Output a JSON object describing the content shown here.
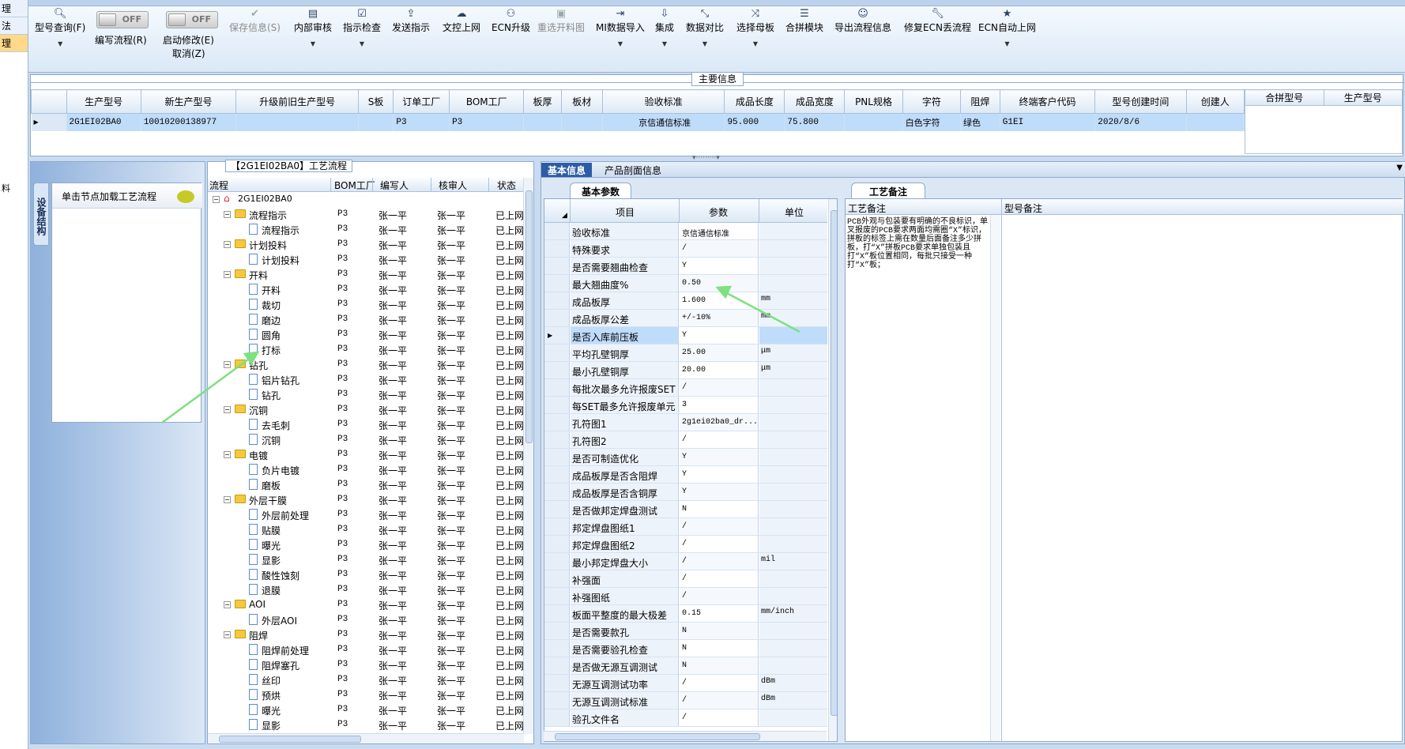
{
  "left_strip": {
    "items": [
      "理",
      "法",
      "理"
    ],
    "frag": "料"
  },
  "toolbar": {
    "model_query": "型号查询(F)",
    "write_flow": "编写流程(R)",
    "auto_modify": "启动修改(E)",
    "cancel": "取消(Z)",
    "toggle_off": "OFF",
    "save_info": "保存信息(S)",
    "internal_review": "内部审核",
    "instruction_check": "指示检查",
    "send_instruction": "发送指示",
    "upload_doc": "文控上网",
    "ecn_upgrade": "ECN升级",
    "reselect_drawing": "重选开料图",
    "mi_import": "MI数据导入",
    "integrate": "集成",
    "data_compare": "数据对比",
    "select_master": "选择母板",
    "merge_module": "合拼模块",
    "export_flow": "导出流程信息",
    "repair_ecn": "修复ECN丢流程",
    "ecn_auto_upload": "ECN自动上网"
  },
  "main_info": {
    "title": "主要信息",
    "columns": [
      "生产型号",
      "新生产型号",
      "升级前旧生产型号",
      "S板",
      "订单工厂",
      "BOM工厂",
      "板厚",
      "板材",
      "验收标准",
      "成品长度",
      "成品宽度",
      "PNL规格",
      "字符",
      "阻焊",
      "终端客户代码",
      "型号创建时间",
      "创建人"
    ],
    "row": [
      "2G1EI02BA0",
      "10010200138977",
      "",
      "",
      "P3",
      "P3",
      "",
      "",
      "京信通信标准",
      "95.000",
      "75.800",
      "",
      "白色字符",
      "绿色",
      "G1EI",
      "2020/8/6",
      ""
    ],
    "side_columns": [
      "合拼型号",
      "生产型号"
    ]
  },
  "left_panel": {
    "vtab": "设备结构",
    "msg": "单击节点加载工艺流程"
  },
  "tree": {
    "title": "【2G1EI02BA0】工艺流程",
    "columns": [
      "流程",
      "BOM工厂",
      "编写人",
      "核审人",
      "状态"
    ],
    "root": "2G1EI02BA0",
    "rows": [
      {
        "name": "流程指示",
        "lvl": 1,
        "f": "P3",
        "w": "张一平",
        "r": "张一平",
        "s": "已上网"
      },
      {
        "name": "流程指示",
        "lvl": 2,
        "f": "P3",
        "w": "张一平",
        "r": "张一平",
        "s": "已上网"
      },
      {
        "name": "计划投料",
        "lvl": 1,
        "f": "P3",
        "w": "张一平",
        "r": "张一平",
        "s": "已上网"
      },
      {
        "name": "计划投料",
        "lvl": 2,
        "f": "P3",
        "w": "张一平",
        "r": "张一平",
        "s": "已上网"
      },
      {
        "name": "开料",
        "lvl": 1,
        "f": "P3",
        "w": "张一平",
        "r": "张一平",
        "s": "已上网"
      },
      {
        "name": "开料",
        "lvl": 2,
        "f": "P3",
        "w": "张一平",
        "r": "张一平",
        "s": "已上网"
      },
      {
        "name": "裁切",
        "lvl": 2,
        "f": "P3",
        "w": "张一平",
        "r": "张一平",
        "s": "已上网"
      },
      {
        "name": "磨边",
        "lvl": 2,
        "f": "P3",
        "w": "张一平",
        "r": "张一平",
        "s": "已上网"
      },
      {
        "name": "圆角",
        "lvl": 2,
        "f": "P3",
        "w": "张一平",
        "r": "张一平",
        "s": "已上网"
      },
      {
        "name": "打标",
        "lvl": 2,
        "f": "P3",
        "w": "张一平",
        "r": "张一平",
        "s": "已上网"
      },
      {
        "name": "钻孔",
        "lvl": 1,
        "f": "P3",
        "w": "张一平",
        "r": "张一平",
        "s": "已上网"
      },
      {
        "name": "铝片钻孔",
        "lvl": 2,
        "f": "P3",
        "w": "张一平",
        "r": "张一平",
        "s": "已上网"
      },
      {
        "name": "钻孔",
        "lvl": 2,
        "f": "P3",
        "w": "张一平",
        "r": "张一平",
        "s": "已上网"
      },
      {
        "name": "沉铜",
        "lvl": 1,
        "f": "P3",
        "w": "张一平",
        "r": "张一平",
        "s": "已上网"
      },
      {
        "name": "去毛刺",
        "lvl": 2,
        "f": "P3",
        "w": "张一平",
        "r": "张一平",
        "s": "已上网"
      },
      {
        "name": "沉铜",
        "lvl": 2,
        "f": "P3",
        "w": "张一平",
        "r": "张一平",
        "s": "已上网"
      },
      {
        "name": "电镀",
        "lvl": 1,
        "f": "P3",
        "w": "张一平",
        "r": "张一平",
        "s": "已上网"
      },
      {
        "name": "负片电镀",
        "lvl": 2,
        "f": "P3",
        "w": "张一平",
        "r": "张一平",
        "s": "已上网"
      },
      {
        "name": "磨板",
        "lvl": 2,
        "f": "P3",
        "w": "张一平",
        "r": "张一平",
        "s": "已上网"
      },
      {
        "name": "外层干膜",
        "lvl": 1,
        "f": "P3",
        "w": "张一平",
        "r": "张一平",
        "s": "已上网"
      },
      {
        "name": "外层前处理",
        "lvl": 2,
        "f": "P3",
        "w": "张一平",
        "r": "张一平",
        "s": "已上网"
      },
      {
        "name": "贴膜",
        "lvl": 2,
        "f": "P3",
        "w": "张一平",
        "r": "张一平",
        "s": "已上网"
      },
      {
        "name": "曝光",
        "lvl": 2,
        "f": "P3",
        "w": "张一平",
        "r": "张一平",
        "s": "已上网"
      },
      {
        "name": "显影",
        "lvl": 2,
        "f": "P3",
        "w": "张一平",
        "r": "张一平",
        "s": "已上网"
      },
      {
        "name": "酸性蚀刻",
        "lvl": 2,
        "f": "P3",
        "w": "张一平",
        "r": "张一平",
        "s": "已上网"
      },
      {
        "name": "退膜",
        "lvl": 2,
        "f": "P3",
        "w": "张一平",
        "r": "张一平",
        "s": "已上网"
      },
      {
        "name": "AOI",
        "lvl": 1,
        "f": "P3",
        "w": "张一平",
        "r": "张一平",
        "s": "已上网"
      },
      {
        "name": "外层AOI",
        "lvl": 2,
        "f": "P3",
        "w": "张一平",
        "r": "张一平",
        "s": "已上网"
      },
      {
        "name": "阻焊",
        "lvl": 1,
        "f": "P3",
        "w": "张一平",
        "r": "张一平",
        "s": "已上网"
      },
      {
        "name": "阻焊前处理",
        "lvl": 2,
        "f": "P3",
        "w": "张一平",
        "r": "张一平",
        "s": "已上网"
      },
      {
        "name": "阻焊塞孔",
        "lvl": 2,
        "f": "P3",
        "w": "张一平",
        "r": "张一平",
        "s": "已上网"
      },
      {
        "name": "丝印",
        "lvl": 2,
        "f": "P3",
        "w": "张一平",
        "r": "张一平",
        "s": "已上网"
      },
      {
        "name": "预烘",
        "lvl": 2,
        "f": "P3",
        "w": "张一平",
        "r": "张一平",
        "s": "已上网"
      },
      {
        "name": "曝光",
        "lvl": 2,
        "f": "P3",
        "w": "张一平",
        "r": "张一平",
        "s": "已上网"
      },
      {
        "name": "显影",
        "lvl": 2,
        "f": "P3",
        "w": "张一平",
        "r": "张一平",
        "s": "已上网"
      }
    ]
  },
  "right_tabs": {
    "basic": "基本信息",
    "section": "产品剖面信息"
  },
  "params": {
    "tab": "基本参数",
    "columns": [
      "项目",
      "参数",
      "单位"
    ],
    "rows": [
      {
        "k": "验收标准",
        "v": "京信通信标准",
        "u": ""
      },
      {
        "k": "特殊要求",
        "v": "/",
        "u": ""
      },
      {
        "k": "是否需要翘曲检查",
        "v": "Y",
        "u": ""
      },
      {
        "k": "最大翘曲度%",
        "v": "0.50",
        "u": ""
      },
      {
        "k": "成品板厚",
        "v": "1.600",
        "u": "mm"
      },
      {
        "k": "成品板厚公差",
        "v": "+/-10%",
        "u": "mm"
      },
      {
        "k": "是否入库前压板",
        "v": "Y",
        "u": "",
        "cur": true
      },
      {
        "k": "平均孔壁铜厚",
        "v": "25.00",
        "u": "μm"
      },
      {
        "k": "最小孔壁铜厚",
        "v": "20.00",
        "u": "μm"
      },
      {
        "k": "每批次最多允许报废SET",
        "v": "/",
        "u": ""
      },
      {
        "k": "每SET最多允许报废单元",
        "v": "3",
        "u": ""
      },
      {
        "k": "孔符图1",
        "v": "2g1ei02ba0_dr...",
        "u": ""
      },
      {
        "k": "孔符图2",
        "v": "/",
        "u": ""
      },
      {
        "k": "是否可制造优化",
        "v": "Y",
        "u": ""
      },
      {
        "k": "成品板厚是否含阻焊",
        "v": "Y",
        "u": ""
      },
      {
        "k": "成品板厚是否含铜厚",
        "v": "Y",
        "u": ""
      },
      {
        "k": "是否做邦定焊盘测试",
        "v": "N",
        "u": ""
      },
      {
        "k": "邦定焊盘图纸1",
        "v": "/",
        "u": ""
      },
      {
        "k": "邦定焊盘图纸2",
        "v": "/",
        "u": ""
      },
      {
        "k": "最小邦定焊盘大小",
        "v": "/",
        "u": "mil"
      },
      {
        "k": "补强面",
        "v": "/",
        "u": ""
      },
      {
        "k": "补强图纸",
        "v": "/",
        "u": ""
      },
      {
        "k": "板面平整度的最大极差",
        "v": "0.15",
        "u": "mm/inch"
      },
      {
        "k": "是否需要款孔",
        "v": "N",
        "u": ""
      },
      {
        "k": "是否需要验孔检查",
        "v": "N",
        "u": ""
      },
      {
        "k": "是否做无源互调测试",
        "v": "N",
        "u": ""
      },
      {
        "k": "无源互调测试功率",
        "v": "/",
        "u": "dBm"
      },
      {
        "k": "无源互调测试标准",
        "v": "/",
        "u": "dBm"
      },
      {
        "k": "验孔文件名",
        "v": "/",
        "u": ""
      }
    ]
  },
  "remarks": {
    "tab": "工艺备注",
    "col1": "工艺备注",
    "col2": "型号备注",
    "text": "PCB外观与包装要有明确的不良标识，单叉报废的PCB要求两面均需圈“X”标识，拼板的标签上需在数量后面备注多少拼板，打“X”拼板PCB要求单独包装且打“X”板位置相同，每批只接受一种打“X”板；"
  },
  "colors": {
    "accent": "#2d5ca6",
    "selection": "#bfdcfb",
    "annotation_arrow": "#7ee07e"
  }
}
